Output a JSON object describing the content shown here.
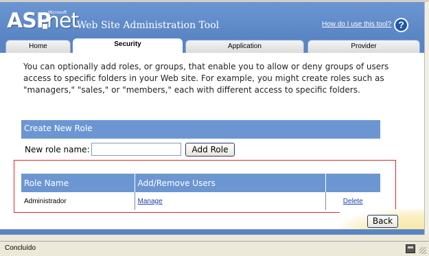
{
  "header": {
    "logo_asp": "ASP",
    "logo_net": "net",
    "logo_ms": "Microsoft",
    "title": "Web Site Administration Tool",
    "help_link": "How do I use this tool?",
    "help_icon": "?"
  },
  "tabs": [
    {
      "label": "Home",
      "active": false
    },
    {
      "label": "Security",
      "active": true
    },
    {
      "label": "Application",
      "active": false
    },
    {
      "label": "Provider",
      "active": false
    }
  ],
  "main": {
    "intro": "You can optionally add roles, or groups, that enable you to allow or deny groups of users access to specific folders in your Web site. For example, you might create roles such as \"managers,\" \"sales,\" or \"members,\" each with different access to specific folders.",
    "create_section": {
      "title": "Create New Role",
      "label": "New role name:",
      "input_value": "",
      "button": "Add Role"
    },
    "roles_table": {
      "headers": [
        "Role Name",
        "Add/Remove Users",
        ""
      ],
      "rows": [
        {
          "role": "Administrador",
          "manage": "Manage",
          "delete": "Delete"
        }
      ]
    },
    "back_button": "Back"
  },
  "statusbar": {
    "text": "Concluído"
  },
  "colors": {
    "header_blue": "#6b96d2",
    "highlight_red": "#e3262b",
    "link_blue": "#1c3fa8"
  }
}
